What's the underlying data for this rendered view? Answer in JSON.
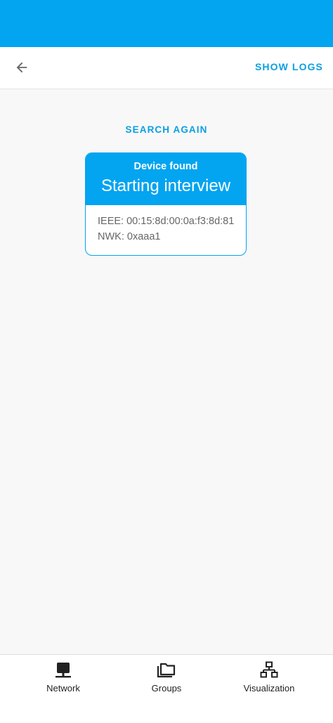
{
  "header": {
    "back_icon": "arrow-back-icon",
    "show_logs_label": "SHOW LOGS"
  },
  "main": {
    "search_again_label": "SEARCH AGAIN",
    "device_card": {
      "title": "Device found",
      "status": "Starting interview",
      "ieee": "IEEE: 00:15:8d:00:0a:f3:8d:81",
      "nwk": "NWK: 0xaaa1"
    }
  },
  "bottom_nav": {
    "items": [
      {
        "label": "Network",
        "icon": "network-icon"
      },
      {
        "label": "Groups",
        "icon": "groups-icon"
      },
      {
        "label": "Visualization",
        "icon": "visualization-icon"
      }
    ]
  },
  "colors": {
    "accent": "#03a4f0",
    "link": "#0a9fe3"
  }
}
